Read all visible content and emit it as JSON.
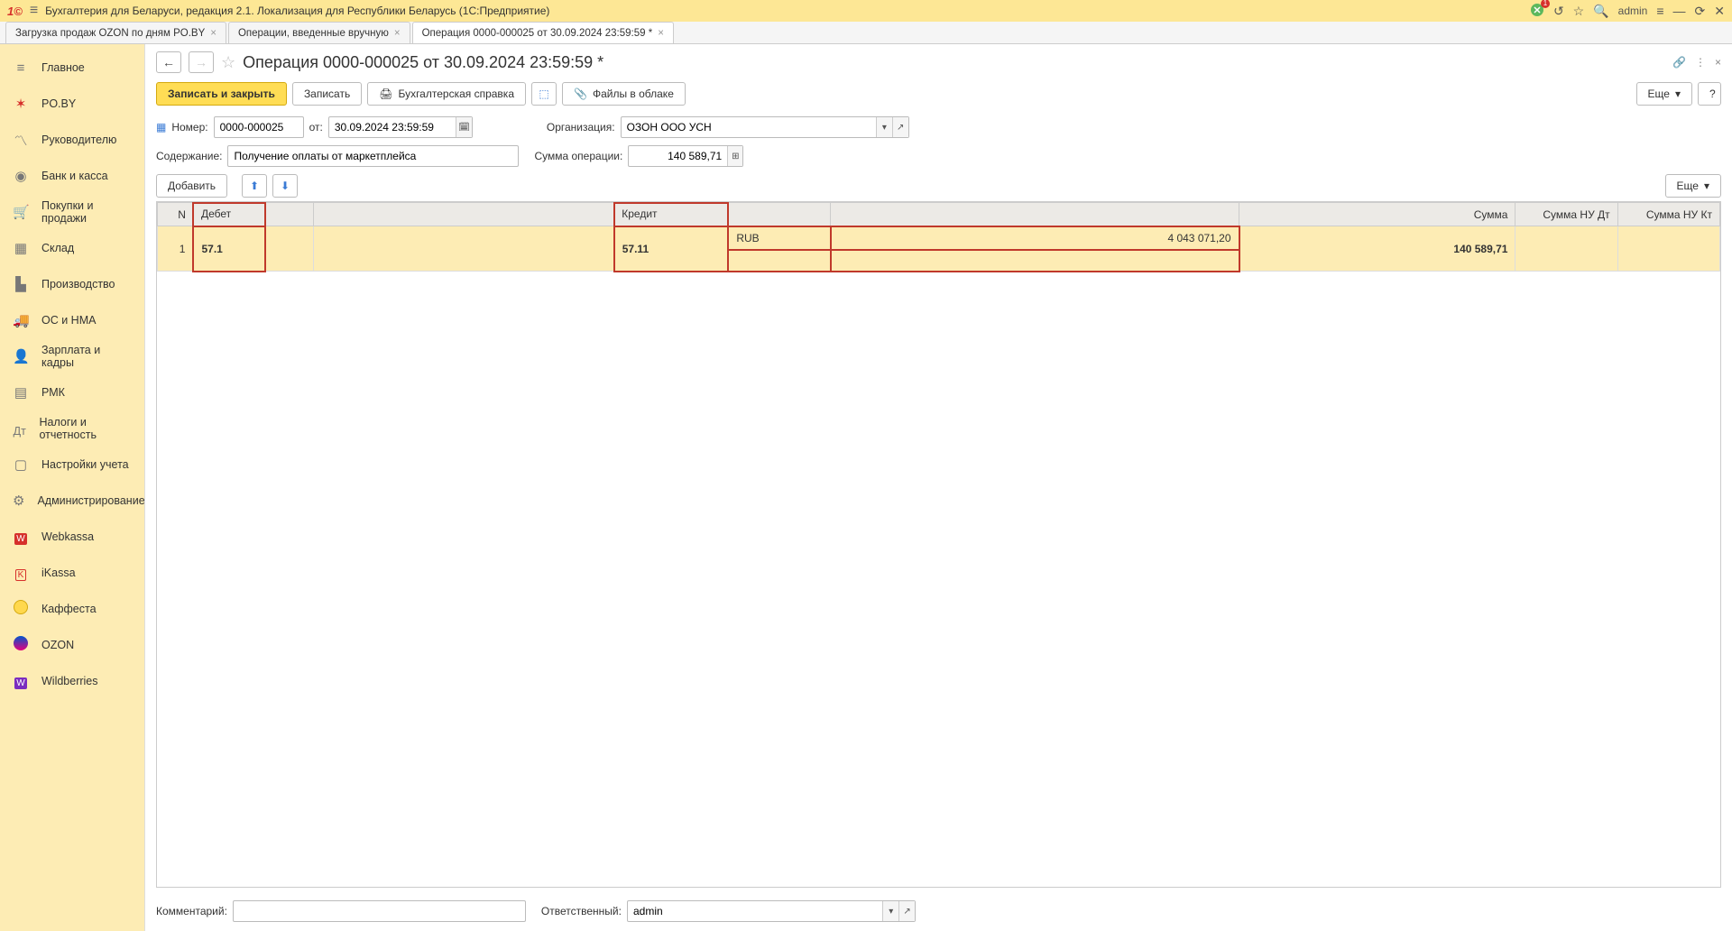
{
  "app": {
    "title": "Бухгалтерия для Беларуси, редакция 2.1. Локализация для Республики Беларусь   (1С:Предприятие)",
    "user": "admin",
    "notif_count": "1"
  },
  "tabs": [
    {
      "label": "Загрузка продаж OZON по дням PO.BY",
      "active": false
    },
    {
      "label": "Операции, введенные вручную",
      "active": false
    },
    {
      "label": "Операция 0000-000025 от 30.09.2024 23:59:59 *",
      "active": true
    }
  ],
  "sidebar": [
    {
      "label": "Главное",
      "icon": "home"
    },
    {
      "label": "PO.BY",
      "icon": "poby"
    },
    {
      "label": "Руководителю",
      "icon": "chart"
    },
    {
      "label": "Банк и касса",
      "icon": "bank"
    },
    {
      "label": "Покупки и продажи",
      "icon": "cart"
    },
    {
      "label": "Склад",
      "icon": "boxes"
    },
    {
      "label": "Производство",
      "icon": "factory"
    },
    {
      "label": "ОС и НМА",
      "icon": "truck"
    },
    {
      "label": "Зарплата и кадры",
      "icon": "person"
    },
    {
      "label": "РМК",
      "icon": "wallet"
    },
    {
      "label": "Налоги и отчетность",
      "icon": "tax"
    },
    {
      "label": "Настройки учета",
      "icon": "clipboard"
    },
    {
      "label": "Администрирование",
      "icon": "gear"
    },
    {
      "label": "Webkassa",
      "icon": "wk"
    },
    {
      "label": "iKassa",
      "icon": "ik"
    },
    {
      "label": "Каффеста",
      "icon": "kf"
    },
    {
      "label": "OZON",
      "icon": "oz"
    },
    {
      "label": "Wildberries",
      "icon": "wb"
    }
  ],
  "page": {
    "title": "Операция 0000-000025 от 30.09.2024 23:59:59 *"
  },
  "toolbar": {
    "save_close": "Записать и закрыть",
    "save": "Записать",
    "print": "Бухгалтерская справка",
    "files": "Файлы в облаке",
    "more": "Еще"
  },
  "form": {
    "number_label": "Номер:",
    "number": "0000-000025",
    "date_label": "от:",
    "date": "30.09.2024 23:59:59",
    "org_label": "Организация:",
    "org": "ОЗОН ООО УСН",
    "desc_label": "Содержание:",
    "desc": "Получение оплаты от маркетплейса",
    "sum_label": "Сумма операции:",
    "sum": "140 589,71"
  },
  "tabletb": {
    "add": "Добавить",
    "more": "Еще"
  },
  "columns": {
    "n": "N",
    "debit": "Дебет",
    "credit": "Кредит",
    "sum": "Сумма",
    "sum_nu_dt": "Сумма НУ Дт",
    "sum_nu_kt": "Сумма НУ Кт"
  },
  "rows": [
    {
      "n": "1",
      "debit_acc": "57.1",
      "credit_acc": "57.11",
      "credit_cur": "RUB",
      "credit_val": "4 043 071,20",
      "sum": "140 589,71"
    }
  ],
  "bottom": {
    "comment_label": "Комментарий:",
    "comment": "",
    "responsible_label": "Ответственный:",
    "responsible": "admin"
  }
}
